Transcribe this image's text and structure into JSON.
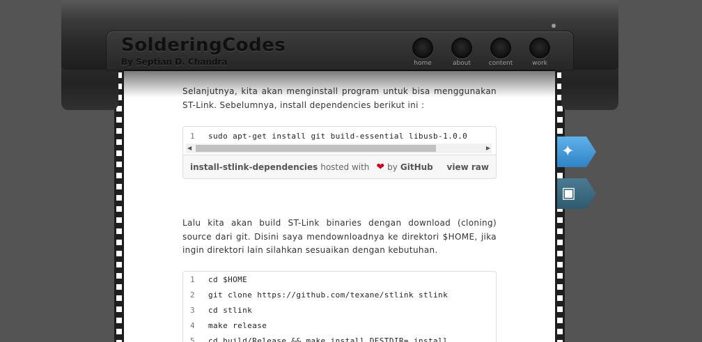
{
  "site": {
    "title": "SolderingCodes",
    "subtitle": "By Septian D. Chandra"
  },
  "nav": [
    {
      "label": "home"
    },
    {
      "label": "about"
    },
    {
      "label": "content"
    },
    {
      "label": "work"
    }
  ],
  "social": {
    "twitter_icon": "twitter-icon",
    "instagram_icon": "instagram-icon",
    "twitter_color": "#3d95d8",
    "instagram_color": "#3c6a82"
  },
  "article": {
    "para1": "Selanjutnya, kita akan menginstall program untuk bisa menggunakan ST-Link. Sebelumnya, install dependencies berikut ini :",
    "gist1": {
      "lines": [
        {
          "n": "1",
          "code": "sudo apt-get install git build-essential libusb-1.0.0"
        }
      ],
      "name": "install-stlink-dependencies",
      "hosted": "hosted with",
      "by": "by",
      "github": "GitHub",
      "view_raw": "view raw"
    },
    "para2": "Lalu kita akan build ST-Link binaries dengan download (cloning) source dari git. Disini saya mendownloadnya ke direktori $HOME, jika ingin direktori lain silahkan sesuaikan dengan kebutuhan.",
    "gist2": {
      "lines": [
        {
          "n": "1",
          "code": "cd $HOME"
        },
        {
          "n": "2",
          "code": "git clone https://github.com/texane/stlink stlink"
        },
        {
          "n": "3",
          "code": "cd stlink"
        },
        {
          "n": "4",
          "code": "make release"
        },
        {
          "n": "5",
          "code": "cd build/Release && make install DESTDIR=_install"
        }
      ]
    }
  }
}
